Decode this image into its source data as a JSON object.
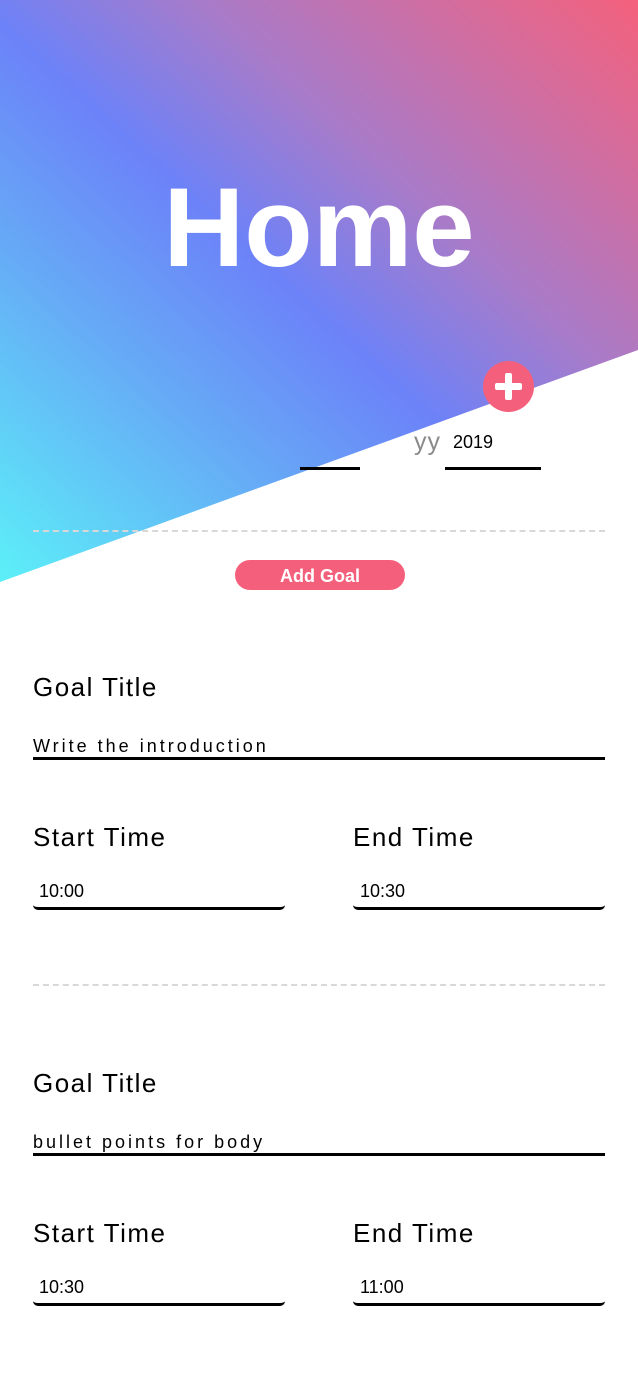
{
  "header": {
    "title": "Home",
    "add_icon": "plus-icon",
    "gradient_colors": [
      "#5cf0f8",
      "#6c82f8",
      "#f4617c"
    ]
  },
  "date": {
    "year_placeholder": "yy",
    "year_value": "2019"
  },
  "actions": {
    "add_goal_label": "Add Goal",
    "accent_color": "#f4607c"
  },
  "goals": [
    {
      "title_label": "Goal Title",
      "title_value": "Write the introduction",
      "start_label": "Start Time",
      "start_value": "10:00",
      "end_label": "End Time",
      "end_value": "10:30"
    },
    {
      "title_label": "Goal Title",
      "title_value": "bullet points for body",
      "start_label": "Start Time",
      "start_value": "10:30",
      "end_label": "End Time",
      "end_value": "11:00"
    }
  ]
}
